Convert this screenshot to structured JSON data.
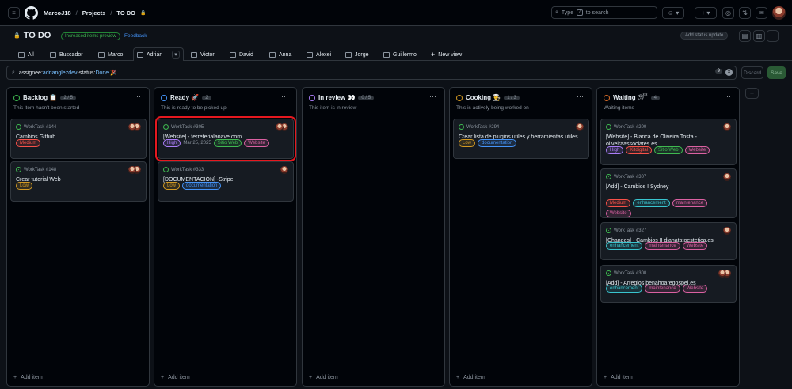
{
  "header": {
    "user": "MarcoJ18",
    "projects": "Projects",
    "project": "TO DO",
    "search_label": "Type",
    "search_key": "/",
    "search_rest": "to search"
  },
  "project": {
    "title": "TO DO",
    "preview_badge": "Increased items preview",
    "feedback": "Feedback",
    "status_update": "Add status update"
  },
  "views": [
    "All",
    "Buscador",
    "Marco",
    "Adrián",
    "Victor",
    "David",
    "Anna",
    "Alexei",
    "Jorge",
    "Guillermo"
  ],
  "new_view": "New view",
  "filter": {
    "k1": "assignee:",
    "v1": "adrianglezdev",
    "k2": " -status:",
    "v2": "Done 🎉",
    "count": "9"
  },
  "actions": {
    "discard": "Discard",
    "save": "Save"
  },
  "add_item": "Add item",
  "colors": {
    "green": "#3fb950",
    "blue": "#4493f8",
    "purple": "#ab7df8",
    "yellow": "#d29922",
    "orange": "#db6d28",
    "highlight": "#e5181f"
  },
  "columns": [
    {
      "name": "Backlog 📋",
      "count": "2 / 5",
      "desc": "This item hasn't been started",
      "color": "#3fb950",
      "cards": [
        {
          "id": "WorkTask #144",
          "title": "Cambios Github",
          "labels": [
            [
              "Medium",
              "#f85149"
            ]
          ],
          "avatars": 2
        },
        {
          "id": "WorkTask #148",
          "title": "Crear tutorial Web",
          "labels": [
            [
              "Low",
              "#d29922"
            ]
          ],
          "avatars": 2
        }
      ]
    },
    {
      "name": "Ready 🚀",
      "count": "2",
      "desc": "This is ready to be picked up",
      "color": "#4493f8",
      "cards": [
        {
          "id": "WorkTask #305",
          "title": "[Website] - ferreterialanave.com",
          "labels": [
            [
              "High",
              "#ab7df8"
            ],
            [
              "Mar 25, 2025",
              ""
            ],
            [
              "Sitio Web",
              "#3fb950"
            ],
            [
              "Website",
              "#db61a2"
            ]
          ],
          "avatars": 2,
          "highlight": true
        },
        {
          "id": "WorkTask #333",
          "title": "[DOCUMENTACIÓN] -Stripe",
          "labels": [
            [
              "Low",
              "#d29922"
            ],
            [
              "documentation",
              "#4493f8"
            ]
          ],
          "avatars": 1
        }
      ]
    },
    {
      "name": "In review 👀",
      "count": "0 / 5",
      "desc": "This item is in review",
      "color": "#ab7df8",
      "cards": []
    },
    {
      "name": "Cooking 👨‍🍳",
      "count": "1 / 3",
      "desc": "This is actively being worked on",
      "color": "#d29922",
      "cards": [
        {
          "id": "WorkTask #294",
          "title": "Crear lista de plugins utiles y herramientas utiles",
          "labels": [
            [
              "Low",
              "#d29922"
            ],
            [
              "documentation",
              "#4493f8"
            ]
          ],
          "avatars": 1
        }
      ]
    },
    {
      "name": "Waiting 😴",
      "count": "4",
      "desc": "Waiting items",
      "color": "#db6d28",
      "cards": [
        {
          "id": "WorkTask #200",
          "title": "[Website] - Bianca de Oliveira Tosta - oliveiraassociates.es",
          "labels": [
            [
              "High",
              "#ab7df8"
            ],
            [
              "Kitdigital",
              "#f85149"
            ],
            [
              "Sitio Web",
              "#3fb950"
            ],
            [
              "Website",
              "#db61a2"
            ]
          ],
          "avatars": 1
        },
        {
          "id": "WorkTask #307",
          "title": "[Add] - Cambios I Sydney",
          "labels": [
            [
              "Medium",
              "#f85149"
            ],
            [
              "enhancement",
              "#39c5cf"
            ],
            [
              "maintenance",
              "#db61a2"
            ],
            [
              "Website",
              "#db61a2"
            ]
          ],
          "avatars": 1
        },
        {
          "id": "WorkTask #327",
          "title": "[Changes] - Cambios II dianatatoestetica.es",
          "labels": [
            [
              "enhancement",
              "#39c5cf"
            ],
            [
              "maintenance",
              "#db61a2"
            ],
            [
              "Website",
              "#db61a2"
            ]
          ],
          "avatars": 1
        },
        {
          "id": "WorkTask #300",
          "title": "[Add] - Arreglos benahoaregospel.es",
          "labels": [
            [
              "enhancement",
              "#39c5cf"
            ],
            [
              "maintenance",
              "#db61a2"
            ],
            [
              "Website",
              "#db61a2"
            ]
          ],
          "avatars": 2
        }
      ]
    }
  ]
}
